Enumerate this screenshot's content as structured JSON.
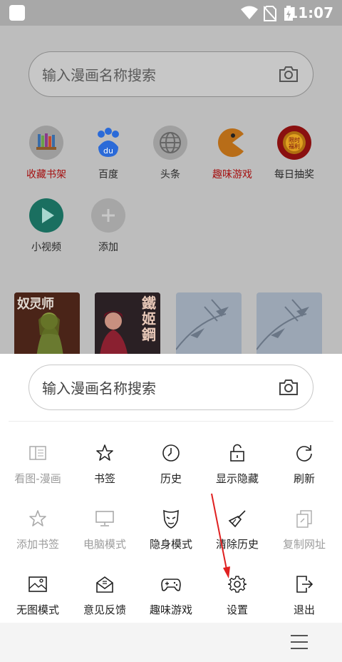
{
  "status_bar": {
    "time": "11:07"
  },
  "background": {
    "search_placeholder": "输入漫画名称搜索",
    "shortcuts": [
      {
        "label": "收藏书架",
        "icon": "bookshelf-icon",
        "color": "#a51010"
      },
      {
        "label": "百度",
        "icon": "baidu-paw-icon"
      },
      {
        "label": "头条",
        "icon": "globe-icon"
      },
      {
        "label": "趣味游戏",
        "icon": "pacman-icon",
        "color": "#a51010"
      },
      {
        "label": "每日抽奖",
        "icon": "lottery-icon"
      },
      {
        "label": "小视频",
        "icon": "play-icon"
      },
      {
        "label": "添加",
        "icon": "plus-icon"
      }
    ],
    "covers": [
      {
        "title": "奴灵师"
      },
      {
        "title": "鐵姬鋼"
      }
    ]
  },
  "menu": {
    "search_placeholder": "输入漫画名称搜索",
    "items": [
      {
        "label": "看图-漫画",
        "icon": "reader-icon",
        "enabled": false
      },
      {
        "label": "书签",
        "icon": "star-icon",
        "enabled": true
      },
      {
        "label": "历史",
        "icon": "clock-icon",
        "enabled": true
      },
      {
        "label": "显示隐藏",
        "icon": "unlock-icon",
        "enabled": true
      },
      {
        "label": "刷新",
        "icon": "refresh-icon",
        "enabled": true
      },
      {
        "label": "添加书签",
        "icon": "star-outline-icon",
        "enabled": false
      },
      {
        "label": "电脑模式",
        "icon": "monitor-icon",
        "enabled": false
      },
      {
        "label": "隐身模式",
        "icon": "mask-icon",
        "enabled": true
      },
      {
        "label": "清除历史",
        "icon": "broom-icon",
        "enabled": true
      },
      {
        "label": "复制网址",
        "icon": "copy-link-icon",
        "enabled": false
      },
      {
        "label": "无图模式",
        "icon": "image-icon",
        "enabled": true
      },
      {
        "label": "意见反馈",
        "icon": "feedback-mail-icon",
        "enabled": true
      },
      {
        "label": "趣味游戏",
        "icon": "gamepad-icon",
        "enabled": true
      },
      {
        "label": "设置",
        "icon": "gear-icon",
        "enabled": true
      },
      {
        "label": "退出",
        "icon": "exit-icon",
        "enabled": true
      }
    ]
  },
  "colors": {
    "accent_red": "#a51010",
    "annotation_arrow": "#e02020"
  }
}
